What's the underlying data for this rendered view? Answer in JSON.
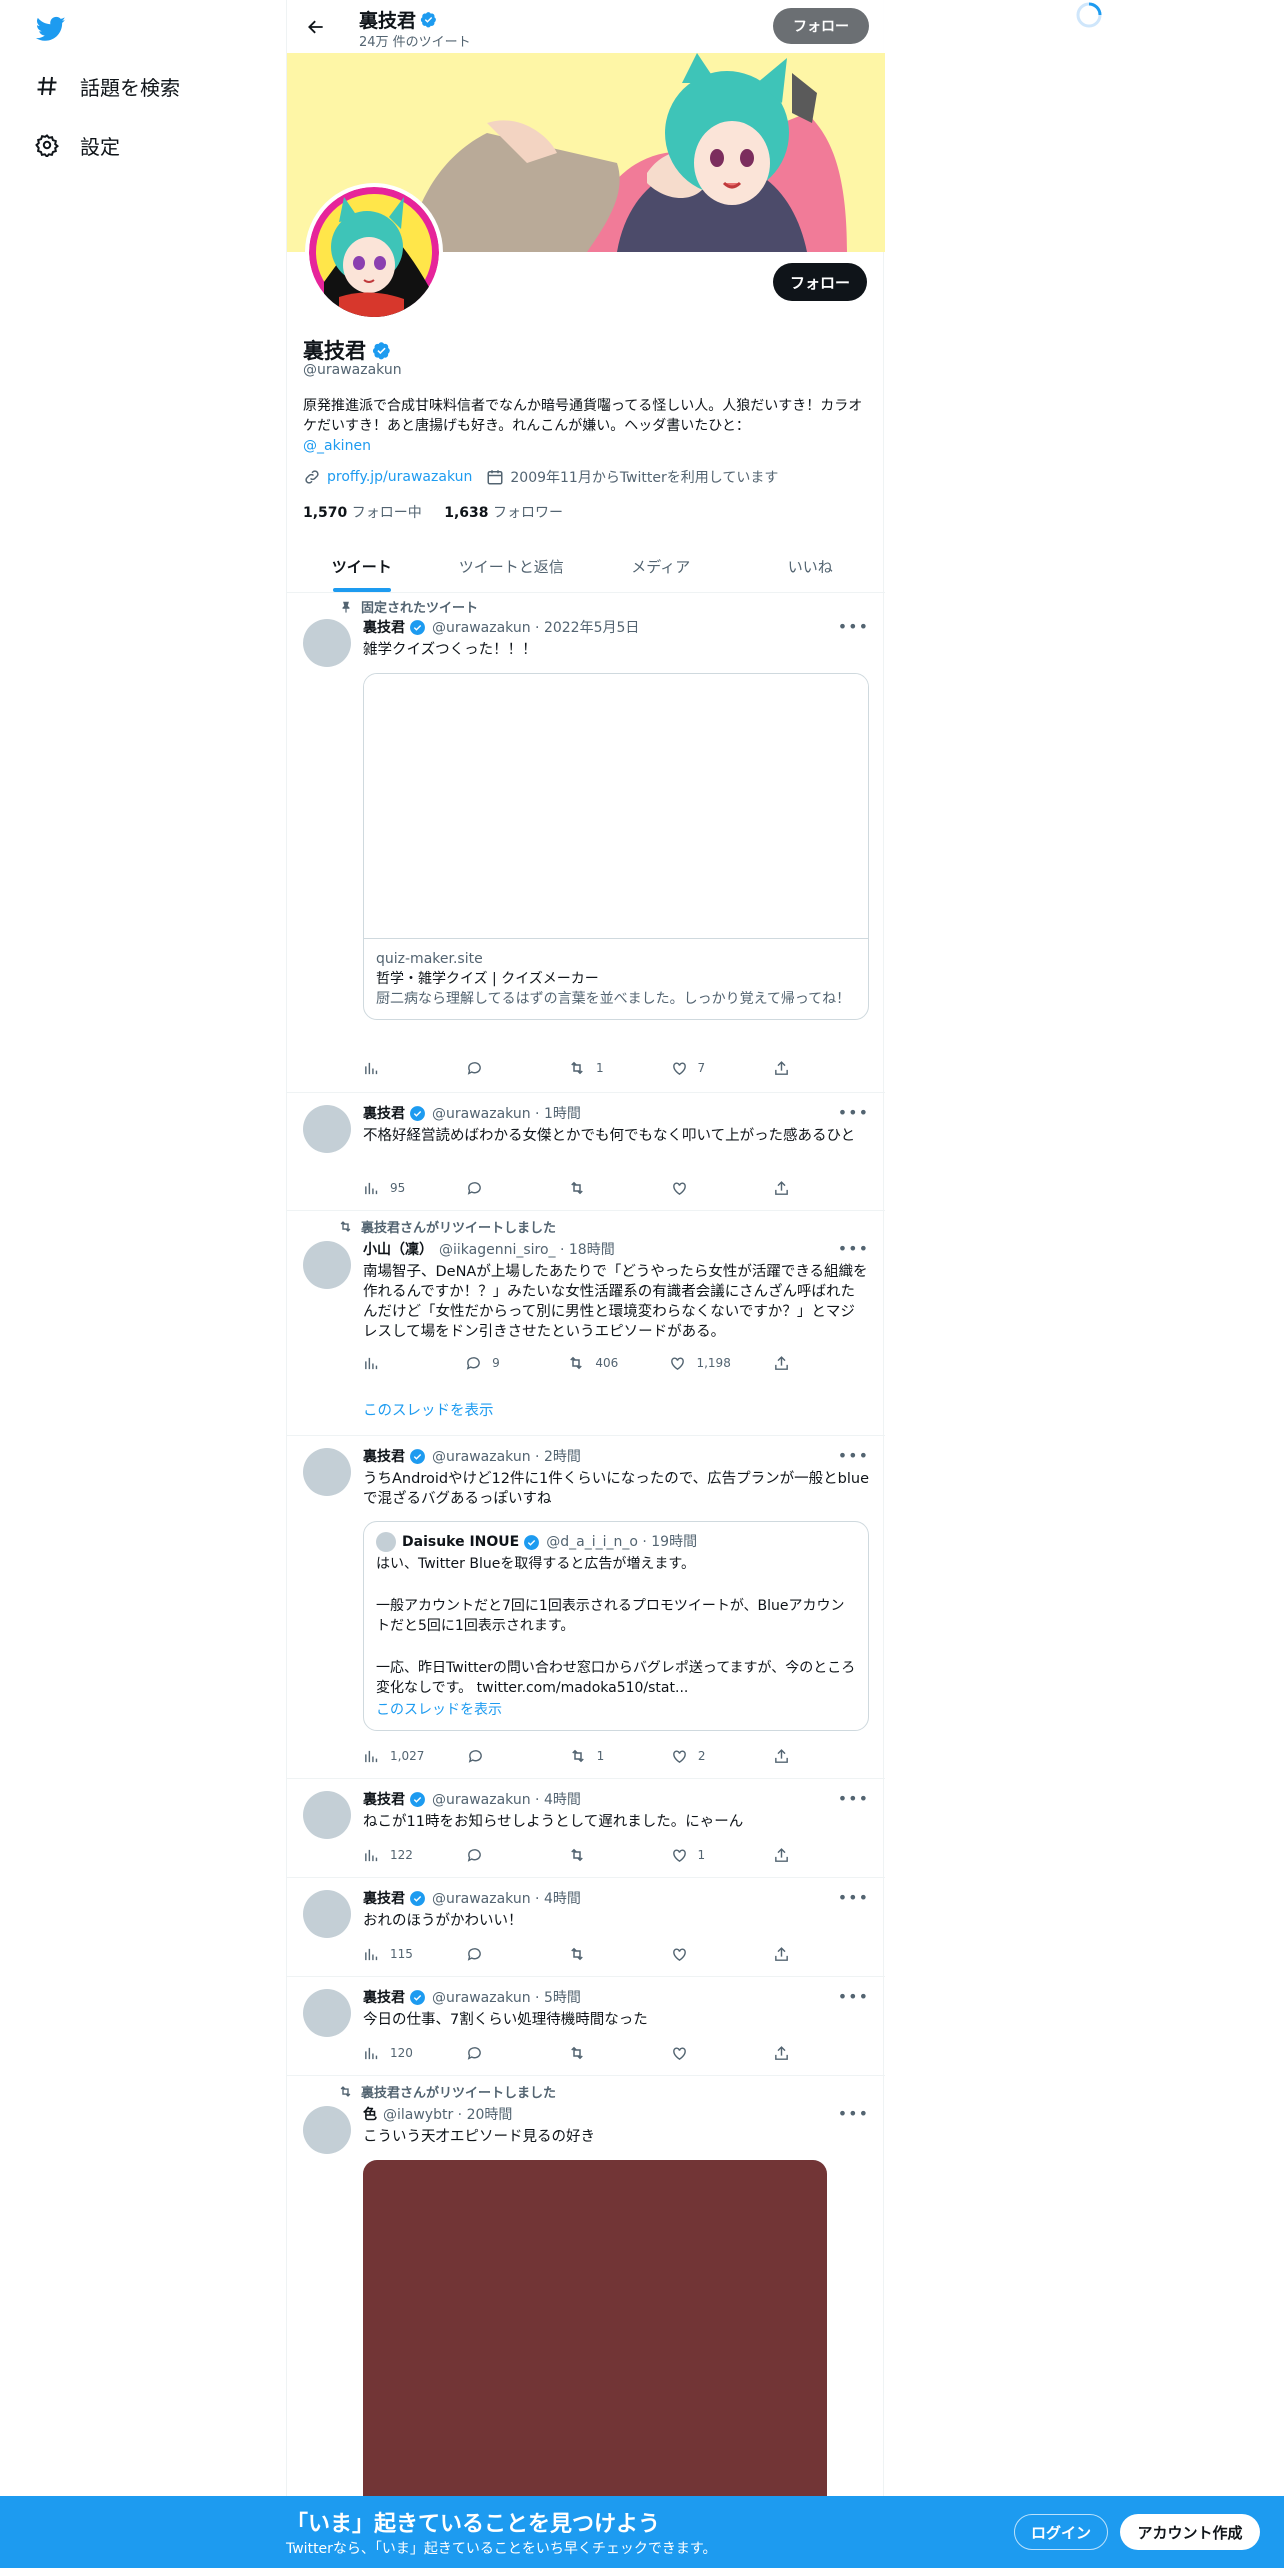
{
  "nav": {
    "explore_label": "話題を検索",
    "settings_label": "設定"
  },
  "header": {
    "name": "裏技君",
    "tweet_count": "24万 件のツイート",
    "follow_label": "フォロー"
  },
  "profile": {
    "follow_label": "フォロー",
    "name": "裏技君",
    "handle": "@urawazakun",
    "bio": "原発推進派で合成甘味料信者でなんか暗号通貨囓ってる怪しい人。人狼だいすき！カラオケだいすき！あと唐揚げも好き。れんこんが嫌い。ヘッダ書いたひと：",
    "bio_mention": "@_akinen",
    "link": "proffy.jp/urawazakun",
    "joined": "2009年11月からTwitterを利用しています",
    "following_count": "1,570",
    "following_label": " フォロー中",
    "followers_count": "1,638",
    "followers_label": " フォロワー"
  },
  "tabs": [
    "ツイート",
    "ツイートと返信",
    "メディア",
    "いいね"
  ],
  "tweets": [
    {
      "context": "固定されたツイート",
      "name": "裏技君",
      "meta": "@urawazakun · 2022年5月5日",
      "text": "雑学クイズつくった！！！",
      "card": {
        "site": "quiz-maker.site",
        "title": "哲学・雑学クイズ | クイズメーカー",
        "desc": "厨二病なら理解してるはずの言葉を並べました。しっかり覚えて帰ってね！"
      },
      "views": "",
      "replies": "",
      "retweets": "1",
      "likes": "7"
    },
    {
      "name": "裏技君",
      "meta": "@urawazakun · 1時間",
      "text": "不格好経営読めばわかる女傑とかでも何でもなく叩いて上がった感あるひと",
      "views": "95",
      "replies": "",
      "retweets": "",
      "likes": ""
    },
    {
      "context": "裏技君さんがリツイートしました",
      "name": "小山（凜）",
      "meta": "@iikagenni_siro_ · 18時間",
      "text": "南場智子、DeNAが上場したあたりで「どうやったら女性が活躍できる組織を作れるんですか！？」みたいな女性活躍系の有識者会議にさんざん呼ばれたんだけど「女性だからって別に男性と環境変わらなくないですか？」とマジレスして場をドン引きさせたというエピソードがある。",
      "views": "",
      "replies": "9",
      "retweets": "406",
      "likes": "1,198",
      "thread": "このスレッドを表示"
    },
    {
      "name": "裏技君",
      "meta": "@urawazakun · 2時間",
      "text": "うちAndroidやけど12件に1件くらいになったので、広告プランが一般とblueで混ざるバグあるっぽいすね",
      "quote": {
        "name": "Daisuke INOUE",
        "meta": "@d_a_i_i_n_o · 19時間",
        "line1": "はい、Twitter Blueを取得すると広告が増えます。",
        "line2": "一般アカウントだと7回に1回表示されるプロモツイートが、Blueアカウントだと5回に1回表示されます。",
        "line3": "一応、昨日Twitterの問い合わせ窓口からバグレポ送ってますが、今のところ変化なしです。 twitter.com/madoka510/stat...",
        "thread": "このスレッドを表示"
      },
      "views": "1,027",
      "replies": "",
      "retweets": "1",
      "likes": "2"
    },
    {
      "name": "裏技君",
      "meta": "@urawazakun · 4時間",
      "text": "ねこが11時をお知らせしようとして遅れました。にゃーん",
      "views": "122",
      "replies": "",
      "retweets": "",
      "likes": "1"
    },
    {
      "name": "裏技君",
      "meta": "@urawazakun · 4時間",
      "text": "おれのほうがかわいい！",
      "views": "115",
      "replies": "",
      "retweets": "",
      "likes": ""
    },
    {
      "name": "裏技君",
      "meta": "@urawazakun · 5時間",
      "text": "今日の仕事、7割くらい処理待機時間なった",
      "views": "120",
      "replies": "",
      "retweets": "",
      "likes": ""
    },
    {
      "context": "裏技君さんがリツイートしました",
      "name": "色",
      "meta": "@ilawybtr · 20時間",
      "text": "こういう天才エピソード見るの好き"
    }
  ],
  "bottombar": {
    "title": "「いま」起きていることを見つけよう",
    "subtitle": "Twitterなら、「いま」起きていることをいち早くチェックできます。",
    "login_label": "ログイン",
    "signup_label": "アカウント作成"
  },
  "colors": {
    "accent": "#1d9bf0",
    "banner_bg": "#fef6a6",
    "media_bg": "#723536"
  }
}
